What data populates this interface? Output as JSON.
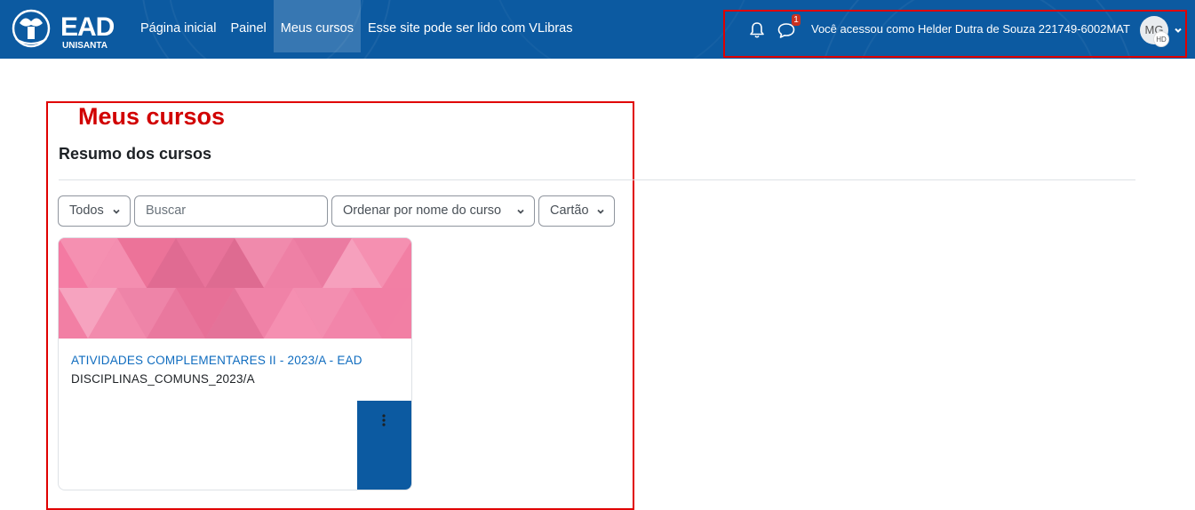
{
  "brand": {
    "logo_text": "EAD",
    "logo_sub": "UNISANTA"
  },
  "nav": {
    "items": [
      {
        "label": "Página inicial",
        "active": false
      },
      {
        "label": "Painel",
        "active": false
      },
      {
        "label": "Meus cursos",
        "active": true
      },
      {
        "label": "Esse site pode ser lido com VLibras",
        "active": false
      }
    ]
  },
  "header": {
    "messages_badge": "1",
    "user_text": "Você acessou como Helder Dutra de Souza 221749-6002MAT",
    "avatar_initials": "MG",
    "avatar_mini_initials": "HD"
  },
  "annotation": {
    "label": "Meus cursos"
  },
  "main": {
    "section_title": "Resumo dos cursos",
    "filters": {
      "grouping": "Todos",
      "search_placeholder": "Buscar",
      "sort": "Ordenar por nome do curso",
      "view": "Cartão"
    },
    "courses": [
      {
        "name": "ATIVIDADES COMPLEMENTARES II - 2023/A - EAD",
        "category": "DISCIPLINAS_COMUNS_2023/A"
      }
    ]
  },
  "colors": {
    "navbar": "#0c5aa1",
    "annotation_red": "#e00000",
    "link_blue": "#0f6cbf",
    "card_pink": "#f57fa3"
  }
}
